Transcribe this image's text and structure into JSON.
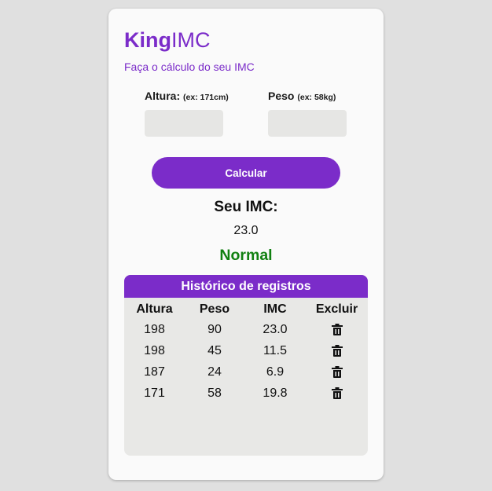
{
  "brand": {
    "bold": "King",
    "light": "IMC"
  },
  "subtitle": "Faça o cálculo do seu IMC",
  "form": {
    "height_label": "Altura:",
    "height_hint": "(ex: 171cm)",
    "height_value": "",
    "weight_label": "Peso",
    "weight_hint": "(ex: 58kg)",
    "weight_value": "",
    "button_label": "Calcular"
  },
  "result": {
    "title": "Seu IMC:",
    "value": "23.0",
    "status": "Normal",
    "status_color": "#118011"
  },
  "history": {
    "title": "Histórico de registros",
    "columns": [
      "Altura",
      "Peso",
      "IMC",
      "Excluir"
    ],
    "rows": [
      {
        "altura": "198",
        "peso": "90",
        "imc": "23.0",
        "action_icon": "trash-icon"
      },
      {
        "altura": "198",
        "peso": "45",
        "imc": "11.5",
        "action_icon": "trash-icon"
      },
      {
        "altura": "187",
        "peso": "24",
        "imc": "6.9",
        "action_icon": "trash-icon"
      },
      {
        "altura": "171",
        "peso": "58",
        "imc": "19.8",
        "action_icon": "trash-icon"
      }
    ]
  },
  "colors": {
    "accent": "#7b2cc9",
    "background": "#e0e0e0",
    "card": "#fafafa",
    "input": "#e6e6e4"
  }
}
